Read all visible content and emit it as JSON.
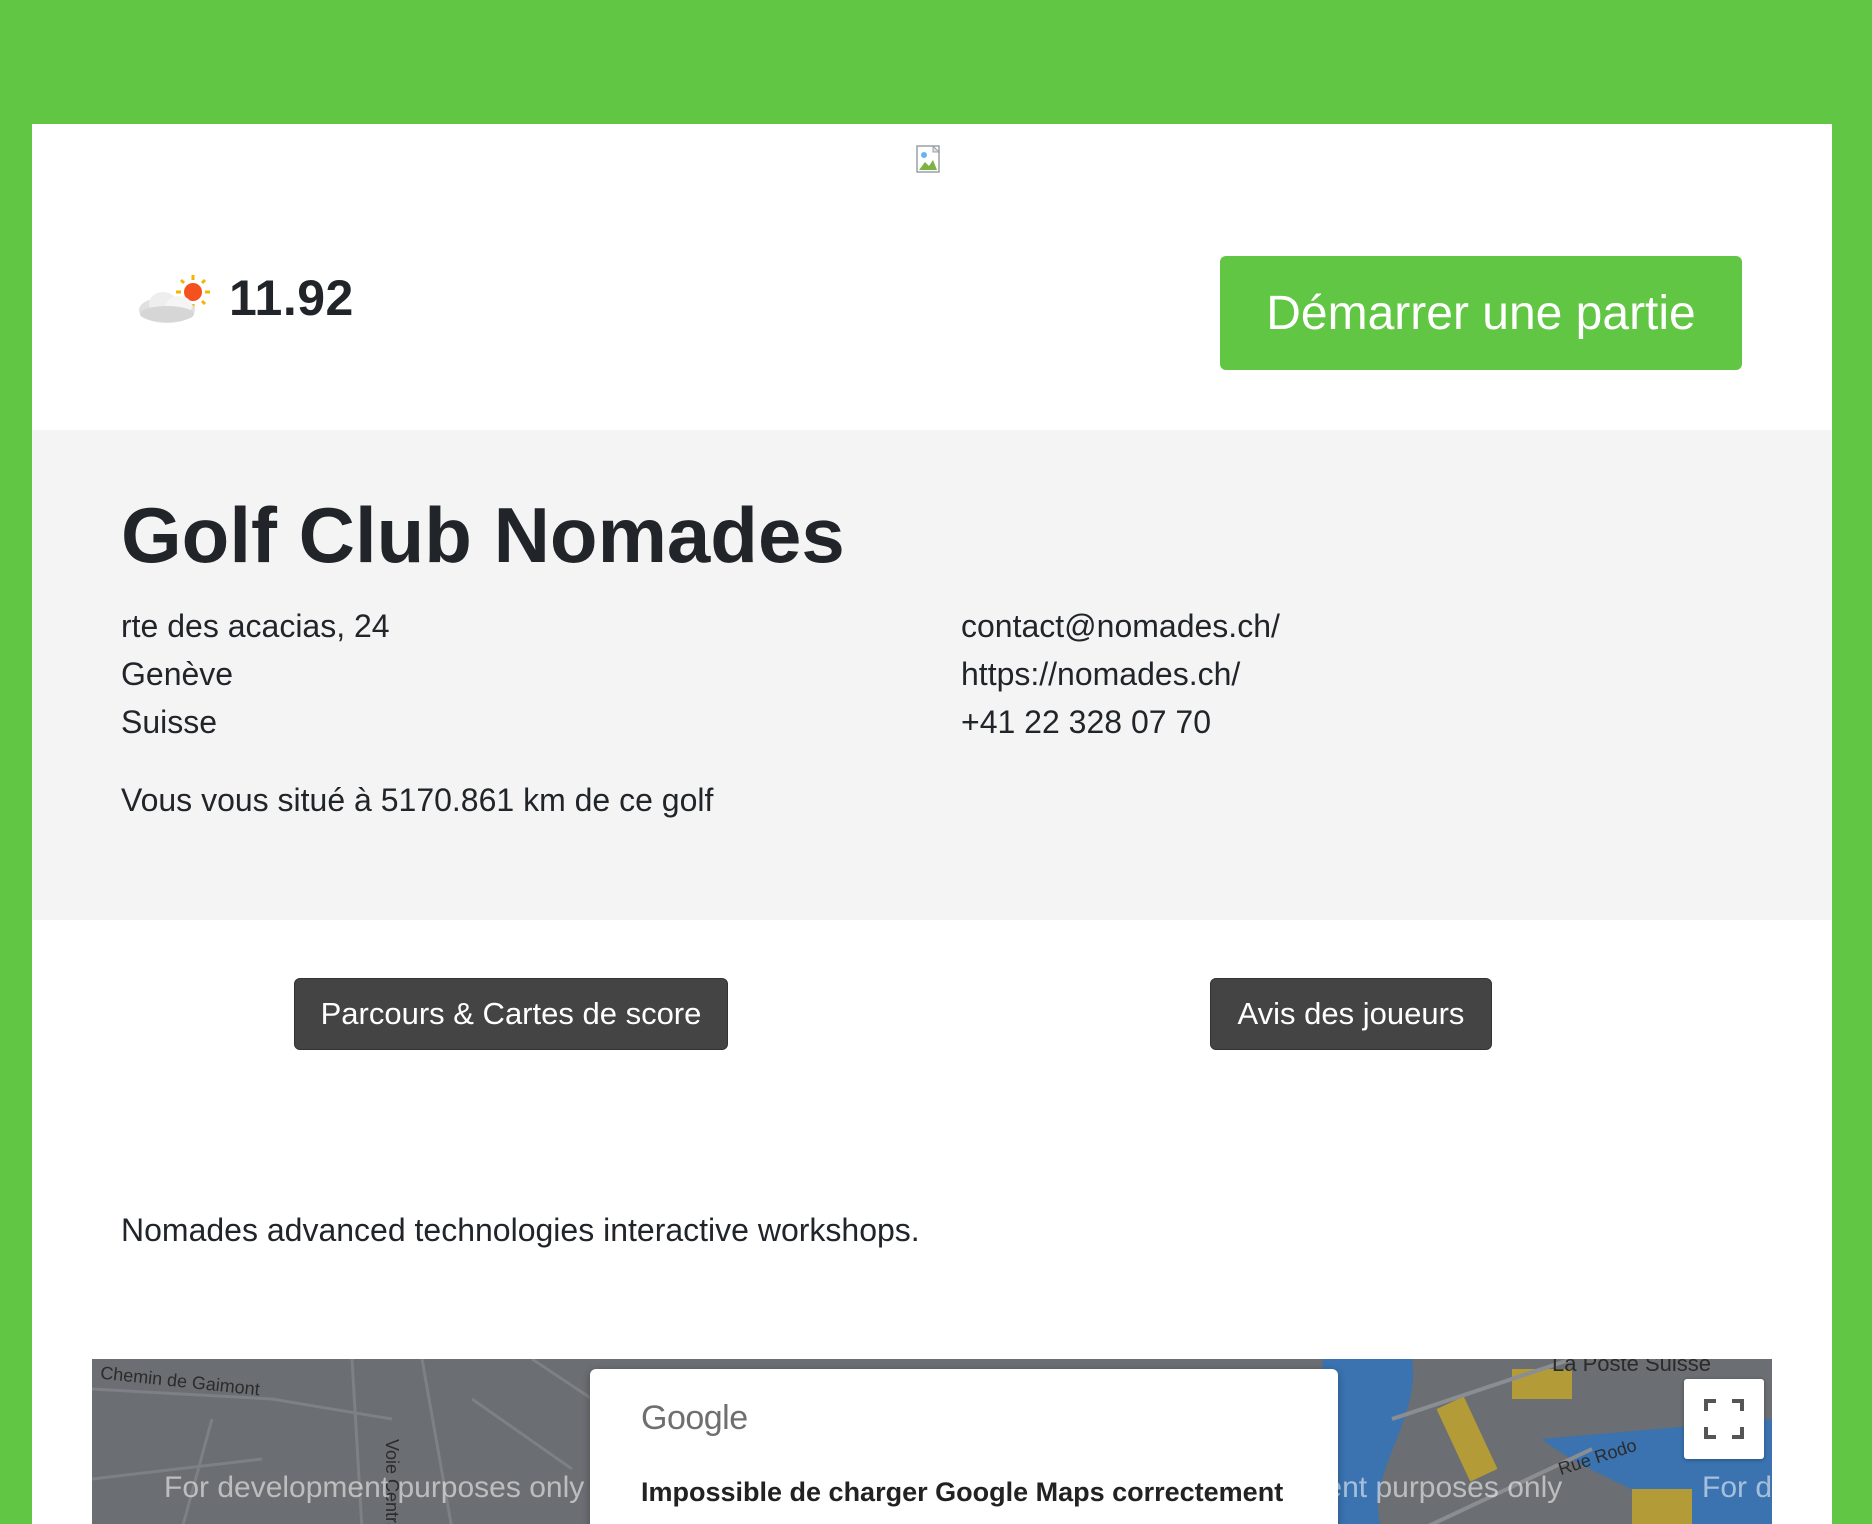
{
  "weather": {
    "icon": "partly-cloudy-sun-icon",
    "temperature": "11.92"
  },
  "header": {
    "start_button_label": "Démarrer une partie"
  },
  "club": {
    "name": "Golf Club Nomades",
    "address": [
      "rte des acacias, 24",
      "Genève",
      "Suisse"
    ],
    "contact": [
      "contact@nomades.ch/",
      "https://nomades.ch/",
      "+41 22 328 07 70"
    ],
    "distance_text": "Vous vous situé à 5170.861 km de ce golf"
  },
  "actions": {
    "courses_label": "Parcours & Cartes de score",
    "reviews_label": "Avis des joueurs"
  },
  "description": "Nomades advanced technologies interactive workshops.",
  "map": {
    "dev_watermark": "For development purposes only",
    "streets": [
      "Chemin de Gaimont",
      "Voie Centrale",
      "Rue Rodo",
      "La Poste Suisse"
    ],
    "dialog_brand": "Google",
    "error_message": "Impossible de charger Google Maps correctement"
  },
  "colors": {
    "brand_green": "#61c643",
    "dark_button": "#444444",
    "panel_gray": "#f4f4f4"
  }
}
